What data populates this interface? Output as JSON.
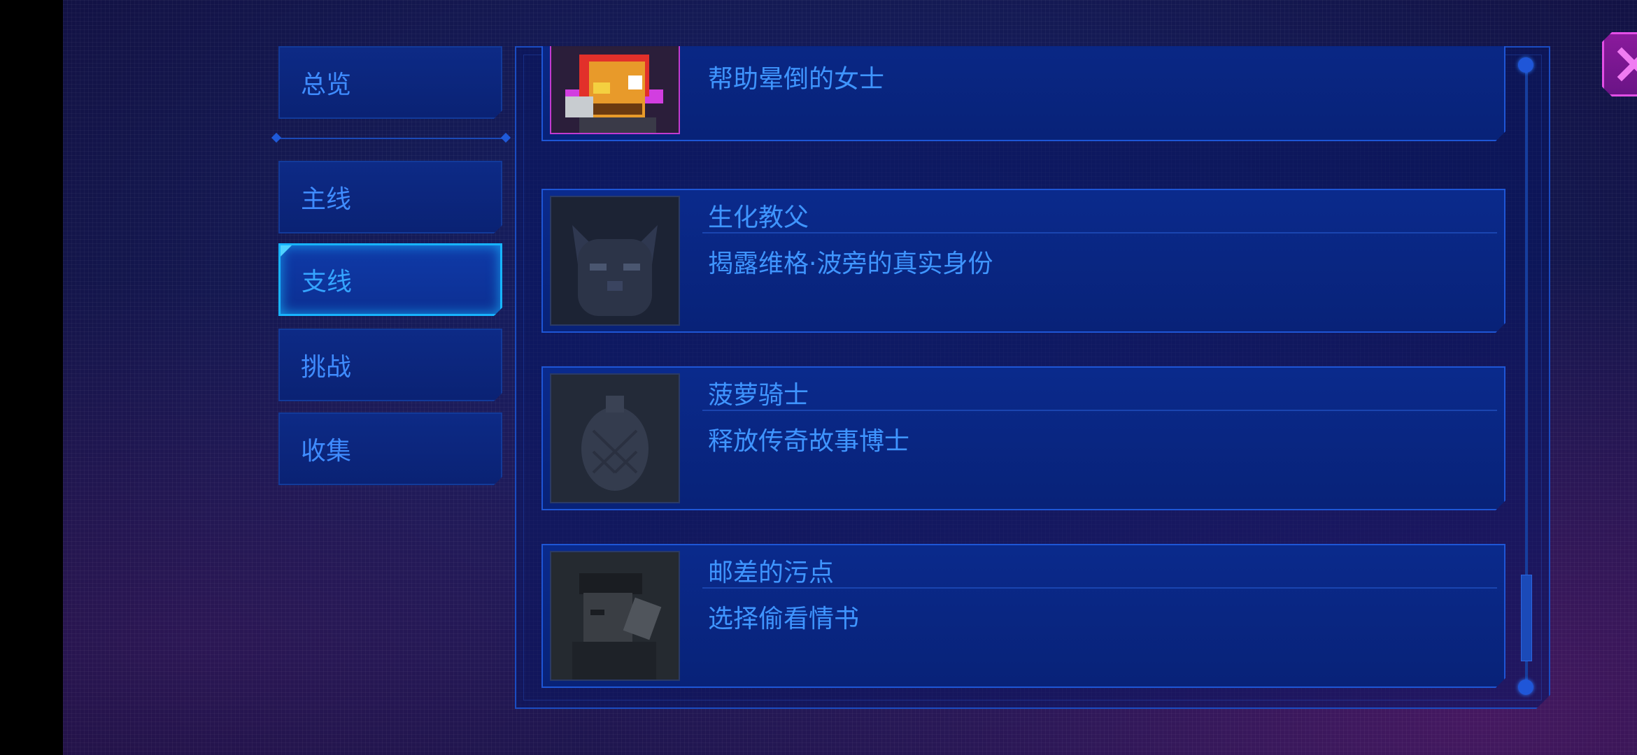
{
  "sidebar": {
    "overview": "总览",
    "tabs": [
      {
        "label": "主线",
        "active": false
      },
      {
        "label": "支线",
        "active": true
      },
      {
        "label": "挑战",
        "active": false
      },
      {
        "label": "收集",
        "active": false
      }
    ]
  },
  "quests": [
    {
      "title": "",
      "description": "帮助晕倒的女士",
      "icon": "mustache-hat-man-portrait",
      "unlocked": true
    },
    {
      "title": "生化教父",
      "description": "揭露维格·波旁的真实身份",
      "icon": "cat-portrait",
      "unlocked": false
    },
    {
      "title": "菠萝骑士",
      "description": "释放传奇故事博士",
      "icon": "pineapple-portrait",
      "unlocked": false
    },
    {
      "title": "邮差的污点",
      "description": "选择偷看情书",
      "icon": "postman-portrait",
      "unlocked": false
    }
  ],
  "colors": {
    "accent": "#18b4ff",
    "text": "#3f95ff",
    "close": "#e24fe6"
  },
  "close_icon": "close-icon"
}
